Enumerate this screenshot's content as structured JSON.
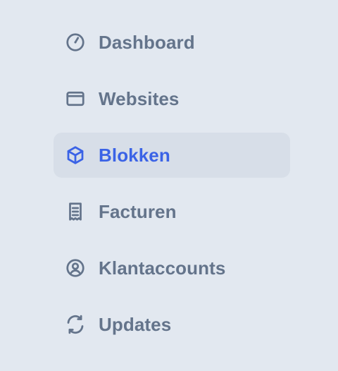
{
  "sidebar": {
    "items": [
      {
        "label": "Dashboard",
        "icon": "gauge-icon",
        "active": false
      },
      {
        "label": "Websites",
        "icon": "browser-window-icon",
        "active": false
      },
      {
        "label": "Blokken",
        "icon": "cube-icon",
        "active": true
      },
      {
        "label": "Facturen",
        "icon": "receipt-icon",
        "active": false
      },
      {
        "label": "Klantaccounts",
        "icon": "user-circle-icon",
        "active": false
      },
      {
        "label": "Updates",
        "icon": "refresh-icon",
        "active": false
      }
    ]
  },
  "colors": {
    "background": "#e2e8f0",
    "text_muted": "#64748b",
    "accent": "#3b63e6",
    "active_background": "#d7dee8"
  }
}
